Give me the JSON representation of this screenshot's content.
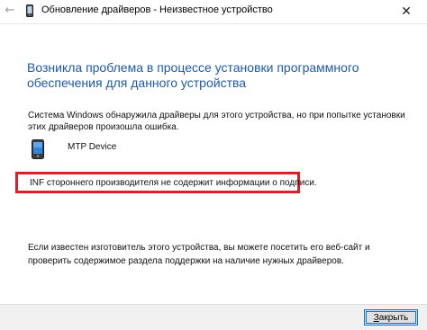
{
  "window": {
    "title": "Обновление драйверов - Неизвестное устройство",
    "back_glyph": "←",
    "close_glyph": "✕"
  },
  "main": {
    "heading": "Возникла проблема в процессе установки программного обеспечения для данного устройства",
    "message": "Система Windows обнаружила драйверы для этого устройства, но при попытке установки этих драйверов произошла ошибка.",
    "device_name": "MTP Device",
    "error_text": "INF стороннего производителя не содержит информации о подписи.",
    "footer_text": "Если известен изготовитель этого устройства, вы можете посетить его веб-сайт и проверить содержимое раздела поддержки на наличие нужных драйверов."
  },
  "buttons": {
    "close_first_letter": "З",
    "close_rest": "акрыть"
  },
  "colors": {
    "heading": "#1f5aa8",
    "error_border": "#e11d2a",
    "button_focus": "#0078d7"
  },
  "icons": {
    "device": "mtp-device-icon",
    "titlebar_device": "device-icon"
  }
}
